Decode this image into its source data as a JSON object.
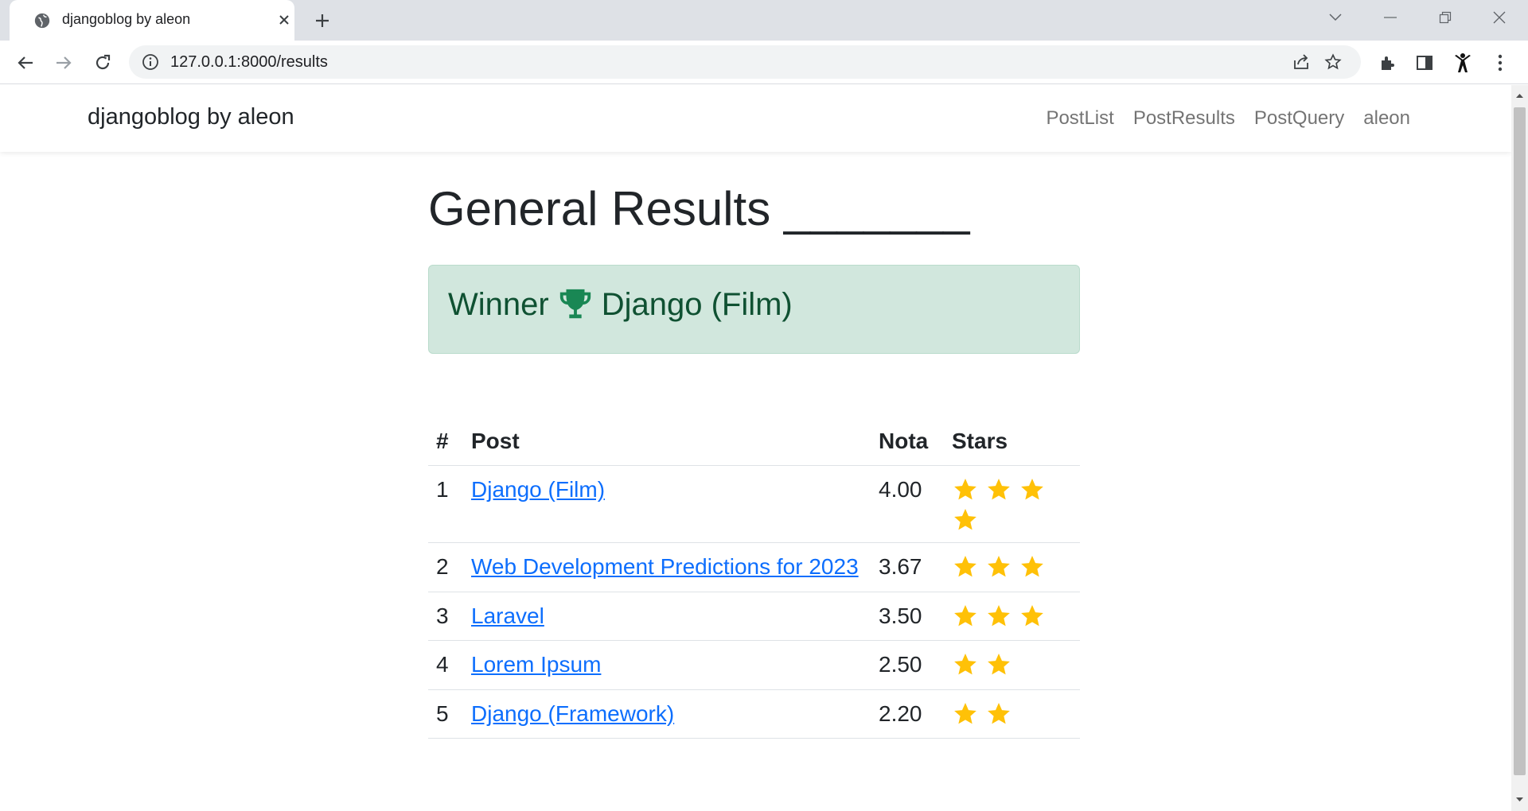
{
  "browser": {
    "tab_title": "djangoblog by aleon",
    "url": "127.0.0.1:8000/results"
  },
  "navbar": {
    "brand": "djangoblog by aleon",
    "links": [
      "PostList",
      "PostResults",
      "PostQuery",
      "aleon"
    ]
  },
  "page": {
    "title": "General Results _______"
  },
  "winner": {
    "label": "Winner",
    "name": "Django (Film)"
  },
  "table": {
    "headers": [
      "#",
      "Post",
      "Nota",
      "Stars"
    ],
    "rows": [
      {
        "num": "1",
        "post": "Django (Film)",
        "nota": "4.00",
        "stars": 4
      },
      {
        "num": "2",
        "post": "Web Development Predictions for 2023",
        "nota": "3.67",
        "stars": 3
      },
      {
        "num": "3",
        "post": "Laravel",
        "nota": "3.50",
        "stars": 3
      },
      {
        "num": "4",
        "post": "Lorem Ipsum",
        "nota": "2.50",
        "stars": 2
      },
      {
        "num": "5",
        "post": "Django (Framework)",
        "nota": "2.20",
        "stars": 2
      }
    ]
  },
  "colors": {
    "link": "#0d6efd",
    "star": "#ffc107",
    "alert_bg": "#d1e7dd",
    "alert_text": "#0f5132"
  },
  "icons": {
    "tab": "globe-icon",
    "winner": "trophy-icon",
    "rating": "star-icon"
  }
}
